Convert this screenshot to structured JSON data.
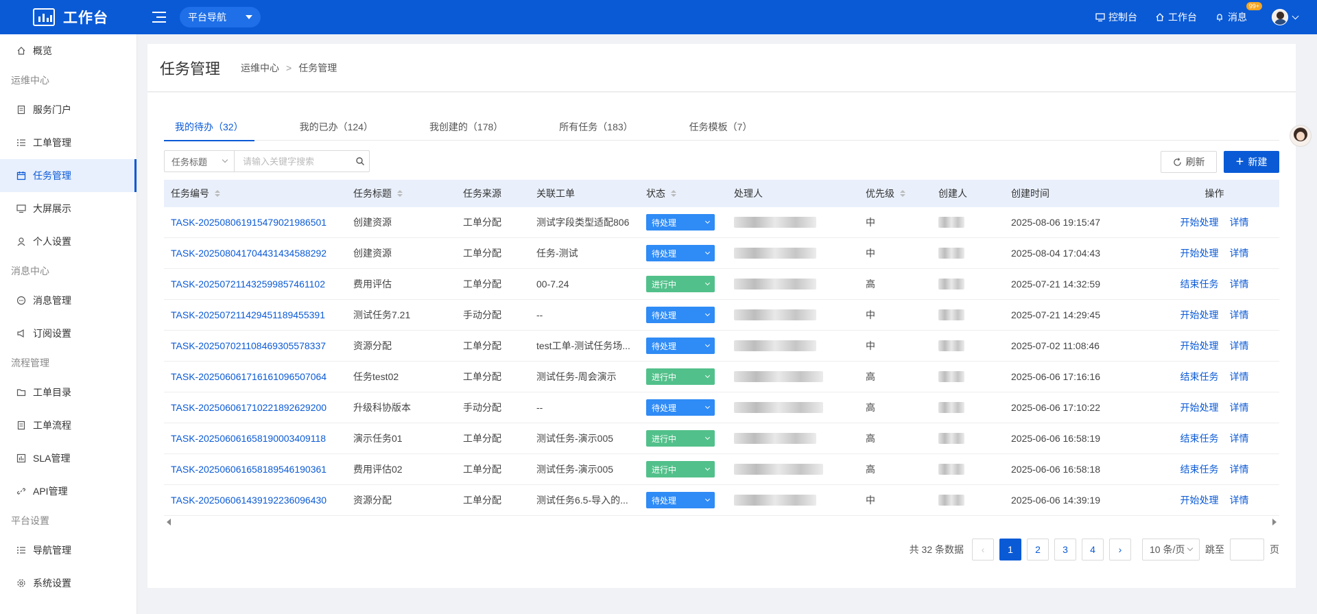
{
  "header": {
    "app_title": "工作台",
    "platform_nav_label": "平台导航",
    "links": [
      {
        "label": "控制台",
        "icon": "monitor-icon"
      },
      {
        "label": "工作台",
        "icon": "home-icon"
      },
      {
        "label": "消息",
        "icon": "bell-icon",
        "badge": "99+"
      }
    ]
  },
  "sidebar": {
    "overview": "概览",
    "groups": [
      {
        "title": "运维中心",
        "items": [
          "服务门户",
          "工单管理",
          "任务管理",
          "大屏展示",
          "个人设置"
        ]
      },
      {
        "title": "消息中心",
        "items": [
          "消息管理",
          "订阅设置"
        ]
      },
      {
        "title": "流程管理",
        "items": [
          "工单目录",
          "工单流程",
          "SLA管理",
          "API管理"
        ]
      },
      {
        "title": "平台设置",
        "items": [
          "导航管理",
          "系统设置"
        ]
      }
    ],
    "active_item": "任务管理"
  },
  "page": {
    "title": "任务管理",
    "breadcrumb": [
      "运维中心",
      "任务管理"
    ],
    "breadcrumb_sep": ">"
  },
  "tabs": [
    "我的待办（32）",
    "我的已办（124）",
    "我创建的（178）",
    "所有任务（183）",
    "任务模板（7）"
  ],
  "search": {
    "field_select": "任务标题",
    "placeholder": "请输入关键字搜索"
  },
  "toolbar": {
    "refresh_label": "刷新",
    "new_label": "新建"
  },
  "table": {
    "columns": [
      "任务编号",
      "任务标题",
      "任务来源",
      "关联工单",
      "状态",
      "处理人",
      "优先级",
      "创建人",
      "创建时间",
      "操作"
    ],
    "rows": [
      {
        "id": "TASK-20250806191547902198650​1",
        "title": "创建资源",
        "source": "工单分配",
        "ticket": "测试字段类型适配806",
        "status": "待处理",
        "priority": "中",
        "created": "2025-08-06 19:15:47",
        "action": "开始处理",
        "detail": "详情"
      },
      {
        "id": "TASK-20250804170443143458829​2",
        "title": "创建资源",
        "source": "工单分配",
        "ticket": "任务-测试",
        "status": "待处理",
        "priority": "中",
        "created": "2025-08-04 17:04:43",
        "action": "开始处理",
        "detail": "详情"
      },
      {
        "id": "TASK-20250721143259985746110​2",
        "title": "费用评估",
        "source": "工单分配",
        "ticket": "00-7.24",
        "status": "进行中",
        "priority": "高",
        "created": "2025-07-21 14:32:59",
        "action": "结束任务",
        "detail": "详情"
      },
      {
        "id": "TASK-20250721142945118945539​1",
        "title": "测试任务7.21",
        "source": "手动分配",
        "ticket": "--",
        "status": "待处理",
        "priority": "中",
        "created": "2025-07-21 14:29:45",
        "action": "开始处理",
        "detail": "详情"
      },
      {
        "id": "TASK-20250702110846930557833​7",
        "title": "资源分配",
        "source": "工单分配",
        "ticket": "test工单-测试任务场...",
        "status": "待处理",
        "priority": "中",
        "created": "2025-07-02 11:08:46",
        "action": "开始处理",
        "detail": "详情"
      },
      {
        "id": "TASK-20250606171616109650706​4",
        "title": "任务test02",
        "source": "工单分配",
        "ticket": "测试任务-周会演示",
        "status": "进行中",
        "priority": "高",
        "created": "2025-06-06 17:16:16",
        "action": "结束任务",
        "detail": "详情"
      },
      {
        "id": "TASK-20250606171022189262920​0",
        "title": "升级科协版本",
        "source": "手动分配",
        "ticket": "--",
        "status": "待处理",
        "priority": "高",
        "created": "2025-06-06 17:10:22",
        "action": "开始处理",
        "detail": "详情"
      },
      {
        "id": "TASK-20250606165819000340911​8",
        "title": "演示任务01",
        "source": "工单分配",
        "ticket": "测试任务-演示005",
        "status": "进行中",
        "priority": "高",
        "created": "2025-06-06 16:58:19",
        "action": "结束任务",
        "detail": "详情"
      },
      {
        "id": "TASK-20250606165818954619036​1",
        "title": "费用评估02",
        "source": "工单分配",
        "ticket": "测试任务-演示005",
        "status": "进行中",
        "priority": "高",
        "created": "2025-06-06 16:58:18",
        "action": "结束任务",
        "detail": "详情"
      },
      {
        "id": "TASK-20250606143919223609643​0",
        "title": "资源分配",
        "source": "工单分配",
        "ticket": "测试任务6.5-导入的...",
        "status": "待处理",
        "priority": "中",
        "created": "2025-06-06 14:39:19",
        "action": "开始处理",
        "detail": "详情"
      }
    ]
  },
  "status_colors": {
    "待处理": "#2f8bf5",
    "进行中": "#52c08a"
  },
  "pagination": {
    "total_text": "共 32 条数据",
    "pages": [
      "1",
      "2",
      "3",
      "4"
    ],
    "current": "1",
    "page_size": "10 条/页",
    "jump_label": "跳至",
    "jump_suffix": "页"
  }
}
